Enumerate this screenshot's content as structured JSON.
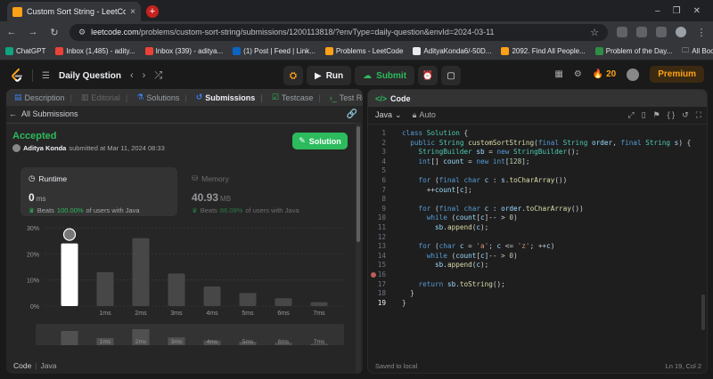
{
  "browser": {
    "tab_title": "Custom Sort String - LeetCode",
    "tab_close": "×",
    "new_tab": "+",
    "win_min": "–",
    "win_max": "❐",
    "win_close": "✕",
    "back": "←",
    "forward": "→",
    "reload": "↻",
    "url_host": "leetcode.com",
    "url_path": "/problems/custom-sort-string/submissions/1200113818/?envType=daily-question&envId=2024-03-11",
    "star": "☆"
  },
  "bookmarks": [
    {
      "label": "ChatGPT",
      "color": "#10a37f"
    },
    {
      "label": "Inbox (1,485) - adity...",
      "color": "#ea4335"
    },
    {
      "label": "Inbox (339) - adityа...",
      "color": "#ea4335"
    },
    {
      "label": "(1) Post | Feed | Link...",
      "color": "#0a66c2"
    },
    {
      "label": "Problems - LeetCode",
      "color": "#ffa116"
    },
    {
      "label": "AdityaKonda6/-50D...",
      "color": "#e8eaed"
    },
    {
      "label": "2092. Find All People...",
      "color": "#ffa116"
    },
    {
      "label": "Problem of the Day...",
      "color": "#2f8d46"
    }
  ],
  "bookmarks_all": "All Bookmarks",
  "lc_header": {
    "daily_question": "Daily Question",
    "run_label": "Run",
    "submit_label": "Submit",
    "streak": "20",
    "premium_label": "Premium"
  },
  "left_tabs": [
    {
      "label": "Description",
      "icon": "📄",
      "state": "normal"
    },
    {
      "label": "Editorial",
      "icon": "📘",
      "state": "disabled"
    },
    {
      "label": "Solutions",
      "icon": "🧪",
      "state": "normal"
    },
    {
      "label": "Submissions",
      "icon": "↺",
      "state": "active"
    },
    {
      "label": "Testcase",
      "icon": "☑",
      "state": "normal"
    },
    {
      "label": "Test Result",
      "icon": "›_",
      "state": "normal"
    }
  ],
  "submission": {
    "all_submissions": "All Submissions",
    "status": "Accepted",
    "author": "Aditya Konda",
    "submitted_text": "submitted at Mar 11, 2024 08:33",
    "solution_button": "Solution"
  },
  "runtime": {
    "label": "Runtime",
    "value": "0",
    "unit": "ms",
    "beats_prefix": "Beats",
    "beats_pct": "100.00%",
    "beats_suffix": "of users with Java"
  },
  "memory": {
    "label": "Memory",
    "value": "40.93",
    "unit": "MB",
    "beats_prefix": "Beats",
    "beats_pct": "86.09%",
    "beats_suffix": "of users with Java"
  },
  "code_footer": {
    "code": "Code",
    "sep": "|",
    "lang": "Java"
  },
  "chart_data": {
    "type": "bar",
    "categories": [
      "0ms",
      "1ms",
      "2ms",
      "3ms",
      "4ms",
      "5ms",
      "6ms",
      "7ms"
    ],
    "tick_labels": [
      "",
      "1ms",
      "2ms",
      "3ms",
      "4ms",
      "5ms",
      "6ms",
      "7ms"
    ],
    "values": [
      24,
      13,
      26,
      12.5,
      7.5,
      5,
      3,
      1.5
    ],
    "highlight_index": 0,
    "ylim": [
      0,
      30
    ],
    "yticks": [
      "30%",
      "20%",
      "10%",
      "0%"
    ],
    "grid": true,
    "overview_values": [
      4,
      2,
      4.5,
      2.2,
      1.3,
      1,
      0.7,
      0.4
    ],
    "bar_color": "#474747",
    "highlight_color": "#ffffff"
  },
  "editor": {
    "tab_label": "Code",
    "language": "Java",
    "mode": "Auto",
    "saved_text": "Saved to local",
    "cursor_pos": "Ln 19, Col 2",
    "current_line": 19,
    "breakpoint_line": 16,
    "lines": [
      "class Solution {",
      "  public String customSortString(final String order, final String s) {",
      "    StringBuilder sb = new StringBuilder();",
      "    int[] count = new int[128];",
      "",
      "    for (final char c : s.toCharArray())",
      "      ++count[c];",
      "",
      "    for (final char c : order.toCharArray())",
      "      while (count[c]-- > 0)",
      "        sb.append(c);",
      "",
      "    for (char c = 'a'; c <= 'z'; ++c)",
      "      while (count[c]-- > 0)",
      "        sb.append(c);",
      "",
      "    return sb.toString();",
      "  }",
      "}"
    ]
  }
}
